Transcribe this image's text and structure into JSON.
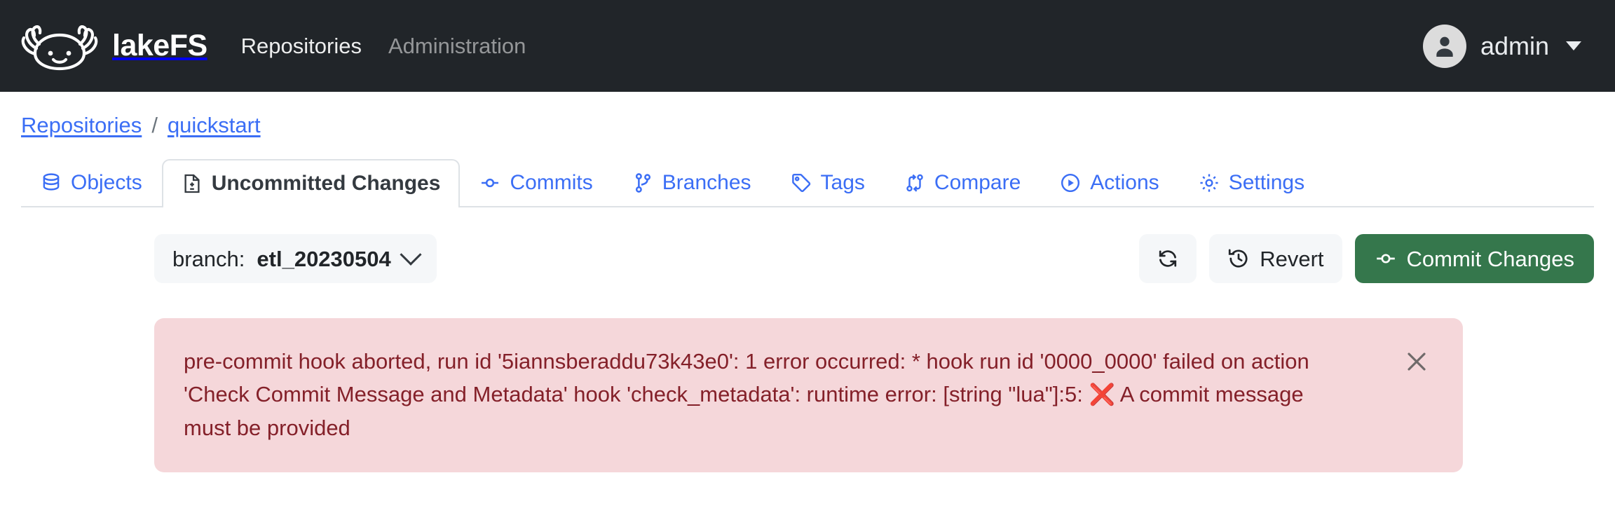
{
  "navbar": {
    "brand_name": "lakeFS",
    "logo_icon": "lakefs-axolotl-logo",
    "links": [
      {
        "label": "Repositories",
        "active": true
      },
      {
        "label": "Administration",
        "active": false
      }
    ],
    "user": {
      "avatar_icon": "user-avatar-icon",
      "name": "admin",
      "caret_icon": "caret-down-icon"
    }
  },
  "breadcrumb": {
    "items": [
      {
        "label": "Repositories"
      },
      {
        "label": "quickstart"
      }
    ],
    "separator": "/"
  },
  "tabs": [
    {
      "label": "Objects",
      "icon": "database-icon",
      "active": false
    },
    {
      "label": "Uncommitted Changes",
      "icon": "file-diff-icon",
      "active": true
    },
    {
      "label": "Commits",
      "icon": "git-commit-icon",
      "active": false
    },
    {
      "label": "Branches",
      "icon": "git-branch-icon",
      "active": false
    },
    {
      "label": "Tags",
      "icon": "tag-icon",
      "active": false
    },
    {
      "label": "Compare",
      "icon": "git-compare-icon",
      "active": false
    },
    {
      "label": "Actions",
      "icon": "play-circle-icon",
      "active": false
    },
    {
      "label": "Settings",
      "icon": "gear-icon",
      "active": false
    }
  ],
  "toolbar": {
    "branch_prefix": "branch:",
    "branch_name": "etl_20230504",
    "branch_caret_icon": "chevron-down-icon",
    "refresh_icon": "refresh-icon",
    "revert_label": "Revert",
    "revert_icon": "history-clock-icon",
    "commit_label": "Commit Changes",
    "commit_icon": "git-commit-icon",
    "commit_button_color": "#35774c"
  },
  "alert": {
    "severity": "error",
    "background_color": "#f5d7da",
    "text_color": "#842029",
    "close_icon": "close-icon",
    "part1": "pre-commit hook aborted, run id '5iannsberaddu73k43e0': 1 error occurred: * hook run id '0000_0000' failed on action 'Check Commit Message and Metadata' hook 'check_metadata': runtime error: [string \"lua\"]:5: ",
    "emoji": "❌",
    "part2": " A commit message must be provided"
  }
}
